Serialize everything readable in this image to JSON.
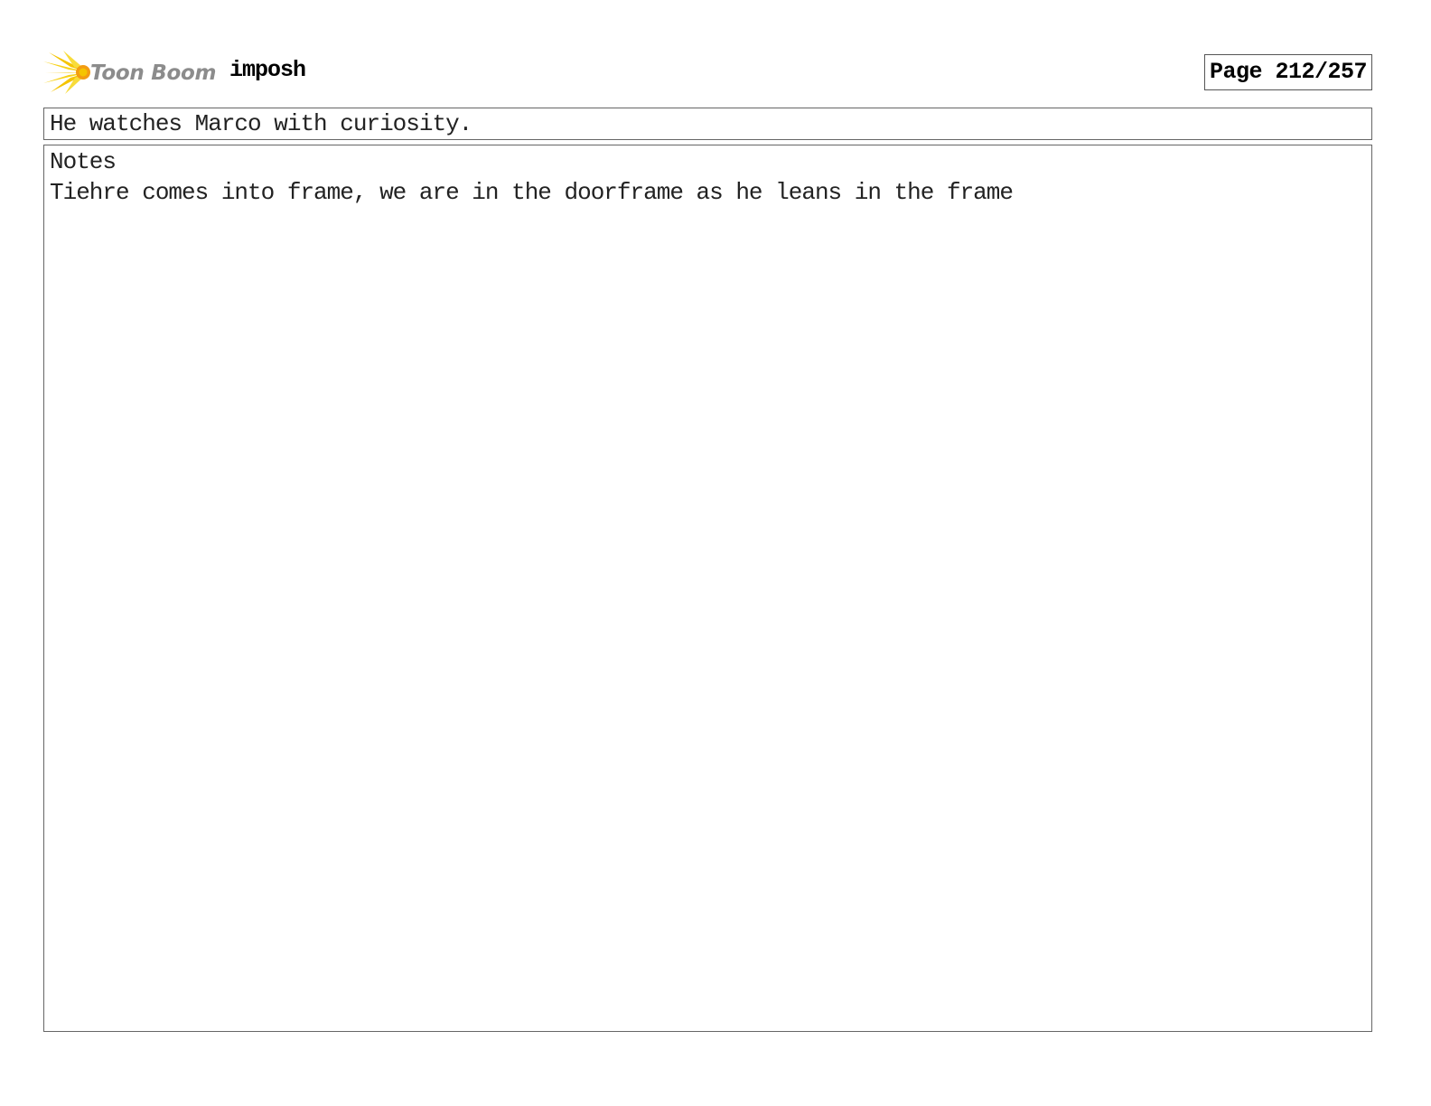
{
  "header": {
    "brand_text": "Toon Boom",
    "logo_icon": "starburst-logo-icon",
    "project_title": "imposh",
    "page_number": "Page 212/257"
  },
  "panel": {
    "caption": "He watches Marco with curiosity.",
    "notes_label": "Notes",
    "notes_text": "Tiehre comes into frame, we are in the doorframe as he leans in the frame"
  },
  "colors": {
    "logo_yellow": "#f5c400",
    "logo_orange": "#f39c12",
    "logo_gray": "#8c8c8c",
    "border": "#666666"
  }
}
